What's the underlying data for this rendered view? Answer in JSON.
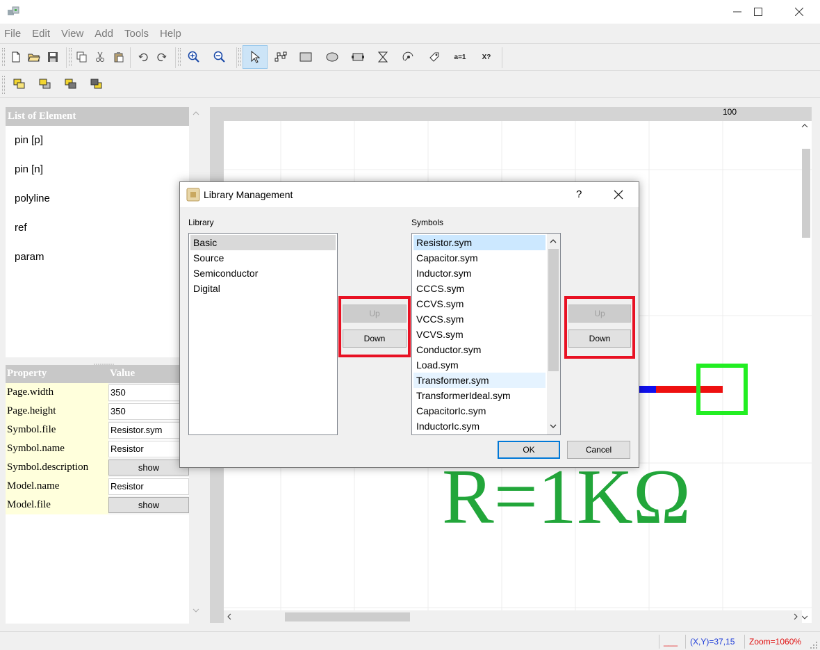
{
  "menu": [
    "File",
    "Edit",
    "View",
    "Add",
    "Tools",
    "Help"
  ],
  "toolbar": {
    "assign_label": "a=1",
    "query_label": "X?"
  },
  "element_list": {
    "header": "List of Element",
    "items": [
      "pin [p]",
      "pin [n]",
      "polyline",
      "ref",
      "param"
    ]
  },
  "properties": {
    "col_property": "Property",
    "col_value": "Value",
    "rows": [
      {
        "key": "Page.width",
        "value": "350"
      },
      {
        "key": "Page.height",
        "value": "350"
      },
      {
        "key": "Symbol.file",
        "value": "Resistor.sym"
      },
      {
        "key": "Symbol.name",
        "value": "Resistor"
      },
      {
        "key": "Symbol.description",
        "button": "show"
      },
      {
        "key": "Model.name",
        "value": "Resistor"
      },
      {
        "key": "Model.file",
        "button": "show"
      }
    ]
  },
  "canvas": {
    "ruler_label": "100",
    "param_text": "R=1KΩ"
  },
  "dialog": {
    "title": "Library Management",
    "help": "?",
    "library_label": "Library",
    "symbols_label": "Symbols",
    "libraries": [
      "Basic",
      "Source",
      "Semiconductor",
      "Digital"
    ],
    "symbols": [
      "Resistor.sym",
      "Capacitor.sym",
      "Inductor.sym",
      "CCCS.sym",
      "CCVS.sym",
      "VCCS.sym",
      "VCVS.sym",
      "Conductor.sym",
      "Load.sym",
      "Transformer.sym",
      "TransformerIdeal.sym",
      "CapacitorIc.sym",
      "InductorIc.sym"
    ],
    "up_label": "Up",
    "down_label": "Down",
    "ok_label": "OK",
    "cancel_label": "Cancel"
  },
  "status": {
    "line_sample": "___",
    "coords": "(X,Y)=37,15",
    "zoom": "Zoom=1060%"
  },
  "colors": {
    "highlight": "#e81123",
    "pin_box": "#22ee22",
    "param_text": "#22a63a",
    "status_text": "#1e3cd8",
    "zoom_text": "#e01010"
  }
}
